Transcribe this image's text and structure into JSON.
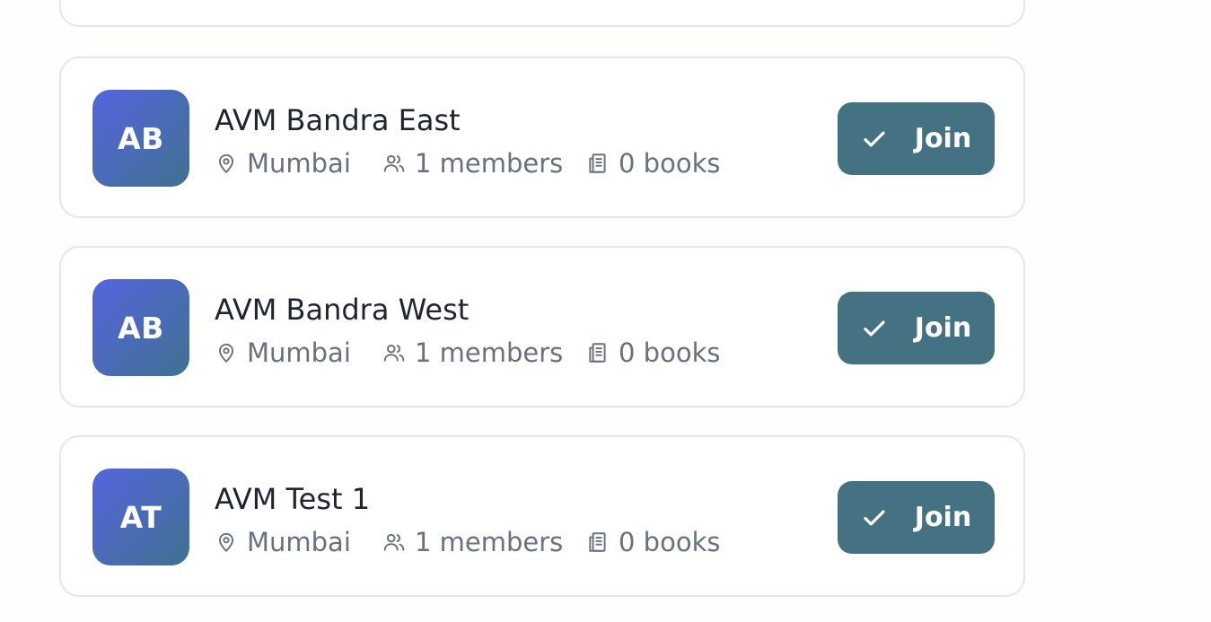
{
  "groups": [
    {
      "initials": "AB",
      "name": "AVM Bandra East",
      "location": "Mumbai",
      "members": "1 members",
      "books": "0 books",
      "join_label": "Join"
    },
    {
      "initials": "AB",
      "name": "AVM Bandra West",
      "location": "Mumbai",
      "members": "1 members",
      "books": "0 books",
      "join_label": "Join"
    },
    {
      "initials": "AT",
      "name": "AVM Test 1",
      "location": "Mumbai",
      "members": "1 members",
      "books": "0 books",
      "join_label": "Join"
    }
  ],
  "icons": {
    "location": "map-pin-icon",
    "members": "users-icon",
    "books": "books-icon",
    "join": "check-icon"
  },
  "colors": {
    "join_button": "#447283",
    "avatar_gradient_start": "#5564df",
    "avatar_gradient_end": "#3f7290"
  }
}
